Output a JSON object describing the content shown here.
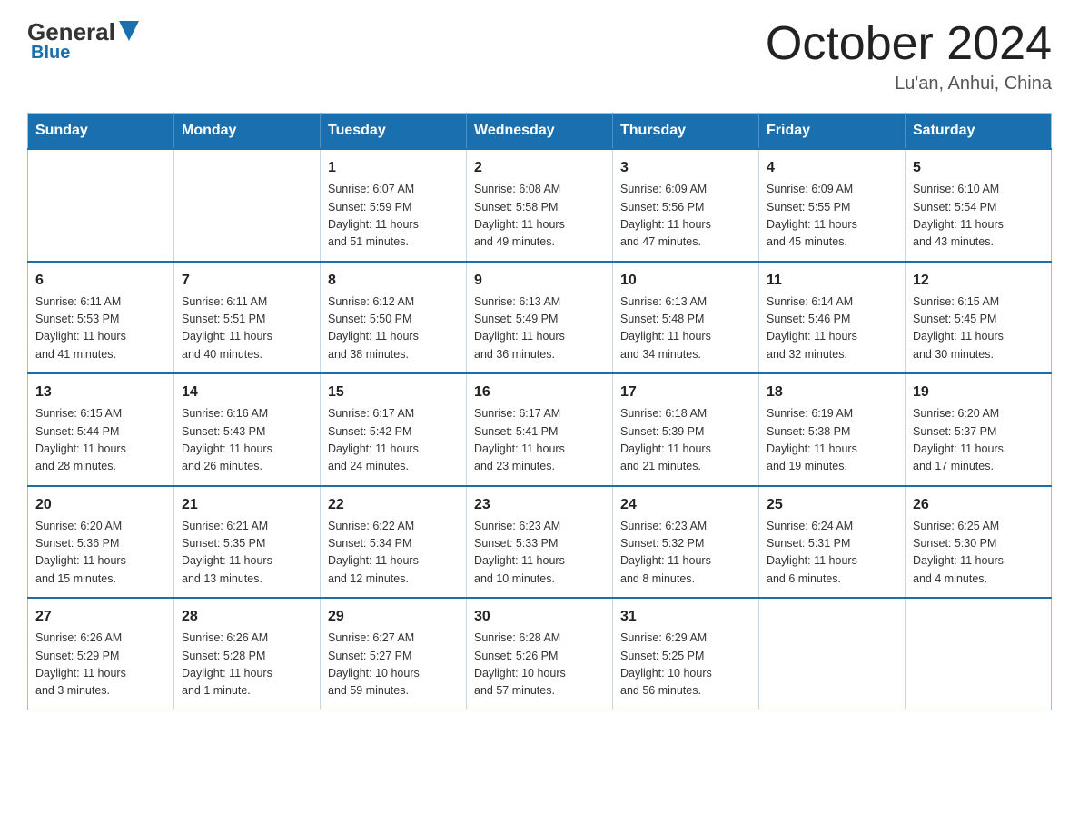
{
  "header": {
    "logo": {
      "general": "General",
      "blue": "Blue",
      "tagline": "Blue"
    },
    "title": "October 2024",
    "subtitle": "Lu'an, Anhui, China"
  },
  "calendar": {
    "days_of_week": [
      "Sunday",
      "Monday",
      "Tuesday",
      "Wednesday",
      "Thursday",
      "Friday",
      "Saturday"
    ],
    "weeks": [
      [
        {
          "day": "",
          "info": ""
        },
        {
          "day": "",
          "info": ""
        },
        {
          "day": "1",
          "info": "Sunrise: 6:07 AM\nSunset: 5:59 PM\nDaylight: 11 hours\nand 51 minutes."
        },
        {
          "day": "2",
          "info": "Sunrise: 6:08 AM\nSunset: 5:58 PM\nDaylight: 11 hours\nand 49 minutes."
        },
        {
          "day": "3",
          "info": "Sunrise: 6:09 AM\nSunset: 5:56 PM\nDaylight: 11 hours\nand 47 minutes."
        },
        {
          "day": "4",
          "info": "Sunrise: 6:09 AM\nSunset: 5:55 PM\nDaylight: 11 hours\nand 45 minutes."
        },
        {
          "day": "5",
          "info": "Sunrise: 6:10 AM\nSunset: 5:54 PM\nDaylight: 11 hours\nand 43 minutes."
        }
      ],
      [
        {
          "day": "6",
          "info": "Sunrise: 6:11 AM\nSunset: 5:53 PM\nDaylight: 11 hours\nand 41 minutes."
        },
        {
          "day": "7",
          "info": "Sunrise: 6:11 AM\nSunset: 5:51 PM\nDaylight: 11 hours\nand 40 minutes."
        },
        {
          "day": "8",
          "info": "Sunrise: 6:12 AM\nSunset: 5:50 PM\nDaylight: 11 hours\nand 38 minutes."
        },
        {
          "day": "9",
          "info": "Sunrise: 6:13 AM\nSunset: 5:49 PM\nDaylight: 11 hours\nand 36 minutes."
        },
        {
          "day": "10",
          "info": "Sunrise: 6:13 AM\nSunset: 5:48 PM\nDaylight: 11 hours\nand 34 minutes."
        },
        {
          "day": "11",
          "info": "Sunrise: 6:14 AM\nSunset: 5:46 PM\nDaylight: 11 hours\nand 32 minutes."
        },
        {
          "day": "12",
          "info": "Sunrise: 6:15 AM\nSunset: 5:45 PM\nDaylight: 11 hours\nand 30 minutes."
        }
      ],
      [
        {
          "day": "13",
          "info": "Sunrise: 6:15 AM\nSunset: 5:44 PM\nDaylight: 11 hours\nand 28 minutes."
        },
        {
          "day": "14",
          "info": "Sunrise: 6:16 AM\nSunset: 5:43 PM\nDaylight: 11 hours\nand 26 minutes."
        },
        {
          "day": "15",
          "info": "Sunrise: 6:17 AM\nSunset: 5:42 PM\nDaylight: 11 hours\nand 24 minutes."
        },
        {
          "day": "16",
          "info": "Sunrise: 6:17 AM\nSunset: 5:41 PM\nDaylight: 11 hours\nand 23 minutes."
        },
        {
          "day": "17",
          "info": "Sunrise: 6:18 AM\nSunset: 5:39 PM\nDaylight: 11 hours\nand 21 minutes."
        },
        {
          "day": "18",
          "info": "Sunrise: 6:19 AM\nSunset: 5:38 PM\nDaylight: 11 hours\nand 19 minutes."
        },
        {
          "day": "19",
          "info": "Sunrise: 6:20 AM\nSunset: 5:37 PM\nDaylight: 11 hours\nand 17 minutes."
        }
      ],
      [
        {
          "day": "20",
          "info": "Sunrise: 6:20 AM\nSunset: 5:36 PM\nDaylight: 11 hours\nand 15 minutes."
        },
        {
          "day": "21",
          "info": "Sunrise: 6:21 AM\nSunset: 5:35 PM\nDaylight: 11 hours\nand 13 minutes."
        },
        {
          "day": "22",
          "info": "Sunrise: 6:22 AM\nSunset: 5:34 PM\nDaylight: 11 hours\nand 12 minutes."
        },
        {
          "day": "23",
          "info": "Sunrise: 6:23 AM\nSunset: 5:33 PM\nDaylight: 11 hours\nand 10 minutes."
        },
        {
          "day": "24",
          "info": "Sunrise: 6:23 AM\nSunset: 5:32 PM\nDaylight: 11 hours\nand 8 minutes."
        },
        {
          "day": "25",
          "info": "Sunrise: 6:24 AM\nSunset: 5:31 PM\nDaylight: 11 hours\nand 6 minutes."
        },
        {
          "day": "26",
          "info": "Sunrise: 6:25 AM\nSunset: 5:30 PM\nDaylight: 11 hours\nand 4 minutes."
        }
      ],
      [
        {
          "day": "27",
          "info": "Sunrise: 6:26 AM\nSunset: 5:29 PM\nDaylight: 11 hours\nand 3 minutes."
        },
        {
          "day": "28",
          "info": "Sunrise: 6:26 AM\nSunset: 5:28 PM\nDaylight: 11 hours\nand 1 minute."
        },
        {
          "day": "29",
          "info": "Sunrise: 6:27 AM\nSunset: 5:27 PM\nDaylight: 10 hours\nand 59 minutes."
        },
        {
          "day": "30",
          "info": "Sunrise: 6:28 AM\nSunset: 5:26 PM\nDaylight: 10 hours\nand 57 minutes."
        },
        {
          "day": "31",
          "info": "Sunrise: 6:29 AM\nSunset: 5:25 PM\nDaylight: 10 hours\nand 56 minutes."
        },
        {
          "day": "",
          "info": ""
        },
        {
          "day": "",
          "info": ""
        }
      ]
    ]
  }
}
